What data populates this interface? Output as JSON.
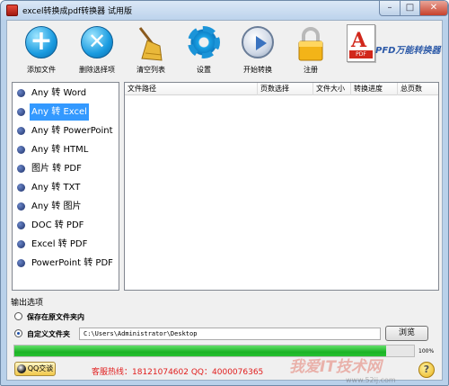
{
  "window": {
    "title": "excel转换成pdf转换器 试用版",
    "min": "–",
    "max": "□",
    "close": "✕"
  },
  "toolbar": {
    "add_file": "添加文件",
    "remove_selected": "删除选择项",
    "clear_list": "清空列表",
    "settings": "设置",
    "start_convert": "开始转换",
    "register": "注册"
  },
  "logo": {
    "brand": "PFD万能转换器",
    "doc_letter": "A",
    "doc_tag": "PDF"
  },
  "modes": [
    {
      "label": "Any 转 Word"
    },
    {
      "label": "Any 转 Excel",
      "selected": true
    },
    {
      "label": "Any 转 PowerPoint"
    },
    {
      "label": "Any 转 HTML"
    },
    {
      "label": "图片 转 PDF"
    },
    {
      "label": "Any 转 TXT"
    },
    {
      "label": "Any 转 图片"
    },
    {
      "label": "DOC 转 PDF"
    },
    {
      "label": "Excel 转 PDF"
    },
    {
      "label": "PowerPoint 转 PDF"
    }
  ],
  "table": {
    "columns": [
      "文件路径",
      "页数选择",
      "文件大小",
      "转换进度",
      "总页数"
    ]
  },
  "output": {
    "group_label": "输出选项",
    "option_source": "保存在原文件夹内",
    "option_custom": "自定义文件夹",
    "custom_selected": true,
    "path": "C:\\Users\\Administrator\\Desktop",
    "browse": "浏览"
  },
  "progress": {
    "value": 0.93,
    "label": "100%"
  },
  "footer": {
    "qq": "QQ交谈",
    "hotline": "客服热线：18121074602 QQ：4000076365",
    "help": "?"
  },
  "watermark": {
    "text": "我爱IT技术网",
    "url": "www.52ij.com"
  },
  "colors": {
    "accent": "#3399ff",
    "progress": "#1cb326",
    "hotline": "#e11d1d"
  }
}
